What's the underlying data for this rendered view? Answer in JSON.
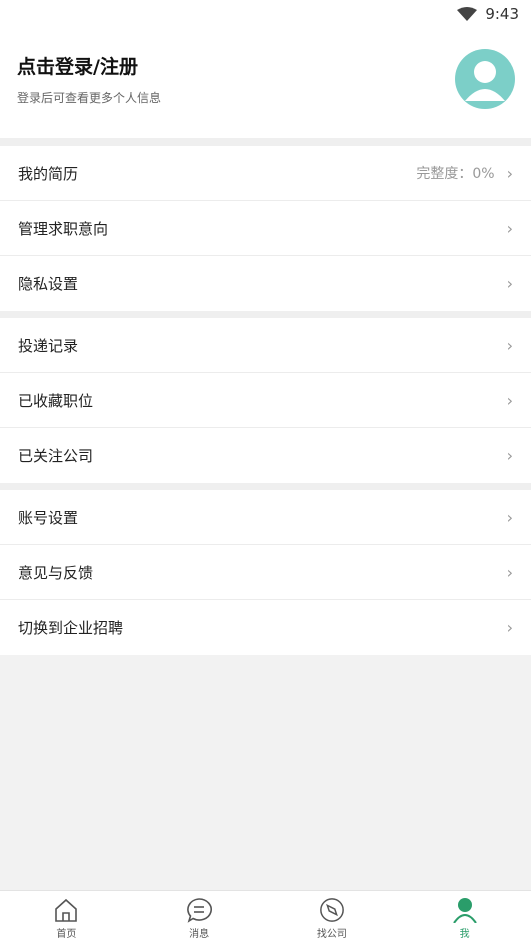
{
  "status_bar": {
    "time": "9:43"
  },
  "profile": {
    "title": "点击登录/注册",
    "subtitle": "登录后可查看更多个人信息"
  },
  "menu": {
    "group1": [
      {
        "label": "我的简历",
        "value": "完整度：0%"
      },
      {
        "label": "管理求职意向"
      },
      {
        "label": "隐私设置"
      }
    ],
    "group2": [
      {
        "label": "投递记录"
      },
      {
        "label": "已收藏职位"
      },
      {
        "label": "已关注公司"
      }
    ],
    "group3": [
      {
        "label": "账号设置"
      },
      {
        "label": "意见与反馈"
      },
      {
        "label": "切换到企业招聘"
      }
    ],
    "chevron": "›"
  },
  "tabbar": {
    "items": [
      {
        "label": "首页",
        "icon": "home-icon"
      },
      {
        "label": "消息",
        "icon": "message-icon"
      },
      {
        "label": "找公司",
        "icon": "compass-icon"
      },
      {
        "label": "我",
        "icon": "person-icon"
      }
    ],
    "active_color": "#2a9d6a"
  }
}
